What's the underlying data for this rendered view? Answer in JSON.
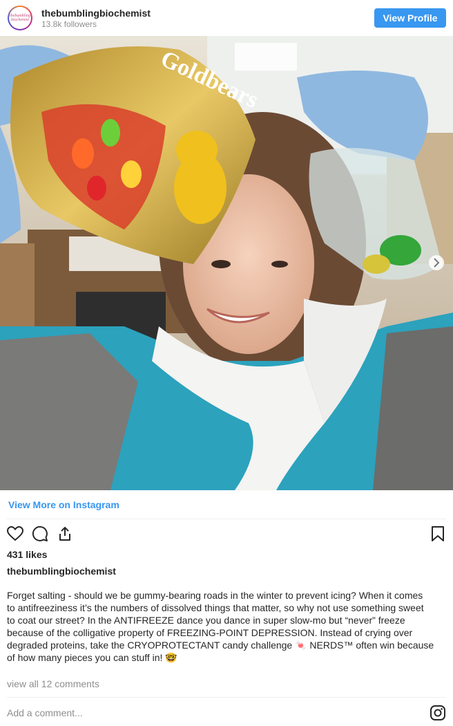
{
  "header": {
    "avatar_text": "thebumbling biochemist",
    "username": "thebumblingbiochemist",
    "followers": "13.8k followers",
    "view_profile_label": "View Profile"
  },
  "post": {
    "image_description": "Scientist in lab holding bag of gummy bears and a jar with gummy bears",
    "bag_text": "Goldbears",
    "view_more_label": "View More on Instagram",
    "likes": "431 likes",
    "caption_username": "thebumblingbiochemist",
    "caption_lines": [
      "Forget salting - should we be gummy-bearing roads in the winter to prevent icing? When it comes",
      "to antifreeziness it’s the numbers of dissolved things that matter, so why not use something sweet",
      "to coat our street? In the ANTIFREEZE dance you dance in super slow-mo but “never” freeze",
      "because of the colligative property of FREEZING-POINT DEPRESSION. Instead of crying over",
      "degraded proteins, take the CRYOPROTECTANT candy challenge 🍬 NERDS™ often win because",
      "of how many pieces you can stuff in! 🤓"
    ],
    "view_comments": "view all 12 comments",
    "add_comment_placeholder": "Add a comment..."
  },
  "icons": {
    "like": "heart-icon",
    "comment": "comment-icon",
    "share": "share-icon",
    "save": "bookmark-icon",
    "next": "chevron-right-icon",
    "instagram": "instagram-logo-icon"
  },
  "colors": {
    "accent": "#3897f0",
    "text": "#262626",
    "muted": "#8e8e8e"
  }
}
